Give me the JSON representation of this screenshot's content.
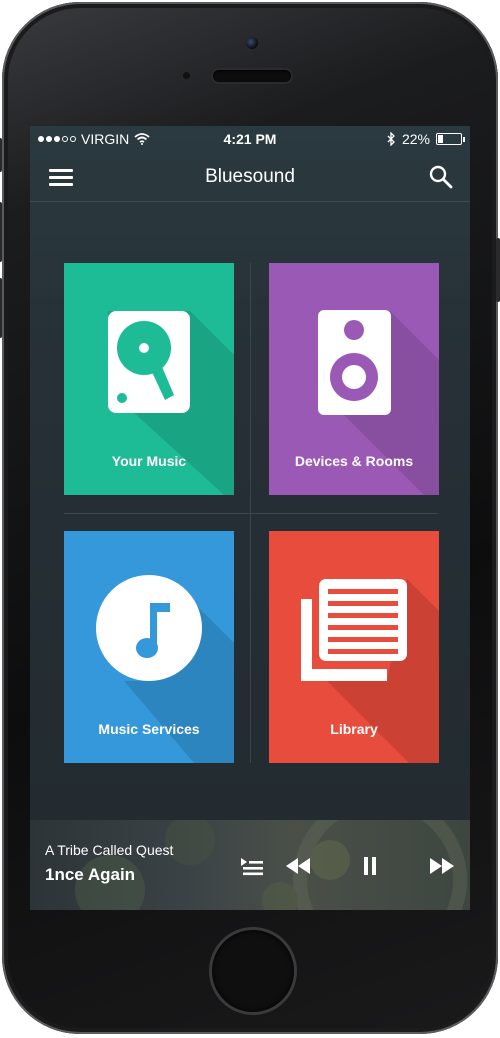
{
  "status_bar": {
    "carrier": "VIRGIN",
    "time": "4:21 PM",
    "battery_percent": "22%",
    "battery_level": 0.22,
    "icons": [
      "signal-dots-icon",
      "wifi-icon",
      "bluetooth-icon",
      "battery-icon"
    ]
  },
  "nav": {
    "title": "Bluesound",
    "menu_icon": "hamburger-menu-icon",
    "search_icon": "search-icon"
  },
  "tiles": [
    {
      "label": "Your Music",
      "color": "#1dbc96",
      "icon": "hard-drive-icon"
    },
    {
      "label": "Devices & Rooms",
      "color": "#9b59b6",
      "icon": "speaker-icon"
    },
    {
      "label": "Music Services",
      "color": "#3498db",
      "icon": "music-note-icon"
    },
    {
      "label": "Library",
      "color": "#e74c3c",
      "icon": "library-list-icon"
    }
  ],
  "now_playing": {
    "artist": "A Tribe Called Quest",
    "track": "1nce Again",
    "controls": [
      "queue-icon",
      "rewind-icon",
      "pause-icon",
      "fast-forward-icon"
    ]
  }
}
